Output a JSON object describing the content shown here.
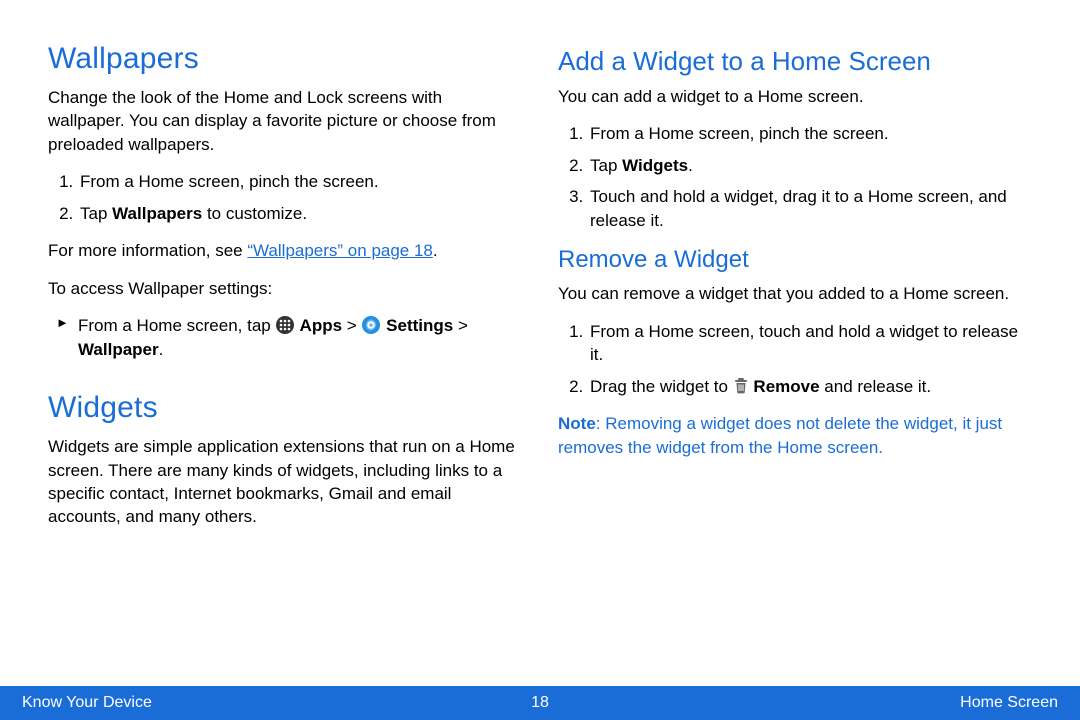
{
  "left": {
    "wallpapers": {
      "title": "Wallpapers",
      "intro": "Change the look of the Home and Lock screens with wallpaper. You can display a favorite picture or choose from preloaded wallpapers.",
      "step1": "From a Home screen, pinch the screen.",
      "step2_pre": "Tap ",
      "step2_bold": "Wallpapers",
      "step2_post": " to customize.",
      "more_pre": "For more information, see ",
      "more_link": "“Wallpapers” on page 18",
      "more_post": ".",
      "access_intro": "To access Wallpaper settings:",
      "access_pre": "From a Home screen, tap ",
      "access_apps": " Apps ",
      "access_gt1": "> ",
      "access_settings": " Settings ",
      "access_gt2": "> ",
      "access_wallpaper": "Wallpaper",
      "access_end": "."
    },
    "widgets": {
      "title": "Widgets",
      "intro": "Widgets are simple application extensions that run on a Home screen. There are many kinds of widgets, including links to a specific contact, Internet bookmarks, Gmail and email accounts, and many others."
    }
  },
  "right": {
    "add": {
      "title": "Add a Widget to a Home Screen",
      "intro": "You can add a widget to a Home screen.",
      "step1": "From a Home screen, pinch the screen.",
      "step2_pre": "Tap ",
      "step2_bold": "Widgets",
      "step2_post": ".",
      "step3": "Touch and hold a widget, drag it to a Home screen, and release it."
    },
    "remove": {
      "title": "Remove a Widget",
      "intro": "You can remove a widget that you added to a Home screen.",
      "step1": "From a Home screen, touch and hold a widget to release it.",
      "step2_pre": "Drag the widget to ",
      "step2_bold": " Remove",
      "step2_post": " and release it.",
      "note_label": "Note",
      "note_text": ": Removing a widget does not delete the widget, it just removes the widget from the Home screen."
    }
  },
  "footer": {
    "left": "Know Your Device",
    "center": "18",
    "right": "Home Screen"
  }
}
